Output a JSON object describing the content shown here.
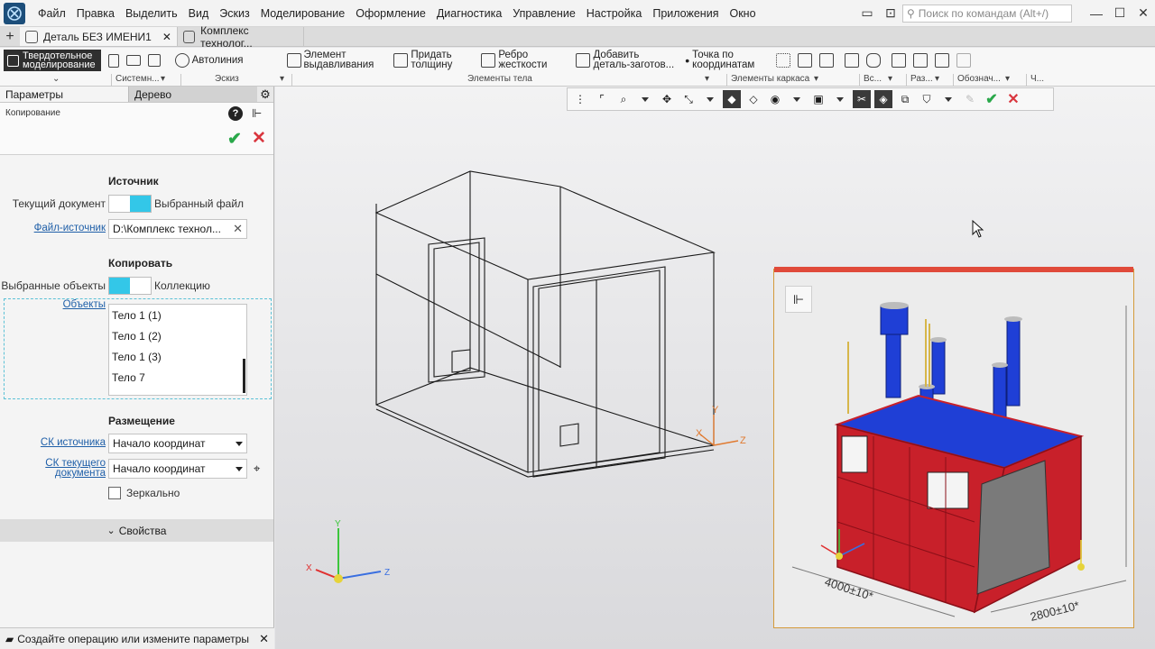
{
  "menu": {
    "items": [
      "Файл",
      "Правка",
      "Выделить",
      "Вид",
      "Эскиз",
      "Моделирование",
      "Оформление",
      "Диагностика",
      "Управление",
      "Настройка",
      "Приложения",
      "Окно"
    ],
    "search_placeholder": "Поиск по командам (Alt+/)"
  },
  "tabs": [
    {
      "label": "Деталь БЕЗ ИМЕНИ1",
      "active": true
    },
    {
      "label": "Комплекс технолог...",
      "active": false
    }
  ],
  "ribbon": {
    "mode_line1": "Твердотельное",
    "mode_line2": "моделирование",
    "autoline": "Автолиния",
    "extrude_l1": "Элемент",
    "extrude_l2": "выдавливания",
    "thicken_l1": "Придать",
    "thicken_l2": "толщину",
    "rib_l1": "Ребро",
    "rib_l2": "жесткости",
    "blank_l1": "Добавить",
    "blank_l2": "деталь-заготов...",
    "point_l1": "Точка по",
    "point_l2": "координатам",
    "groups": [
      "Системн...",
      "Эскиз",
      "Элементы тела",
      "Элементы каркаса",
      "Вс...",
      "Раз...",
      "Обознач...",
      "Ч..."
    ]
  },
  "panel": {
    "tab_params": "Параметры",
    "tab_tree": "Дерево",
    "operation": "Копирование",
    "source_title": "Источник",
    "current_doc": "Текущий документ",
    "selected_file": "Выбранный файл",
    "source_file_link": "Файл-источник",
    "source_file_value": "D:\\Комплекс технол...",
    "copy_title": "Копировать",
    "selected_objects": "Выбранные объекты",
    "collection": "Коллекцию",
    "objects_link": "Объекты",
    "objects": [
      "Тело 1 (1)",
      "Тело 1 (2)",
      "Тело 1 (3)",
      "Тело 7"
    ],
    "placement_title": "Размещение",
    "cs_source_link": "СК источника",
    "cs_source_value": "Начало координат",
    "cs_current_l1": "СК текущего",
    "cs_current_l2": "документа",
    "cs_current_value": "Начало координат",
    "mirror": "Зеркально",
    "properties": "Свойства"
  },
  "status": {
    "text": "Создайте операцию или измените параметры"
  },
  "viewport": {
    "axis_labels": {
      "x": "X",
      "y": "Y",
      "z": "Z"
    },
    "preview_dims": {
      "length": "4000±10*",
      "width": "2800±10*"
    }
  },
  "colors": {
    "accent_cyan": "#33c7e8",
    "ok_green": "#2aa84a",
    "cancel_red": "#d9363e",
    "link_blue": "#1f5fa8",
    "model_red": "#c8202a",
    "model_blue": "#1f3fd6"
  }
}
